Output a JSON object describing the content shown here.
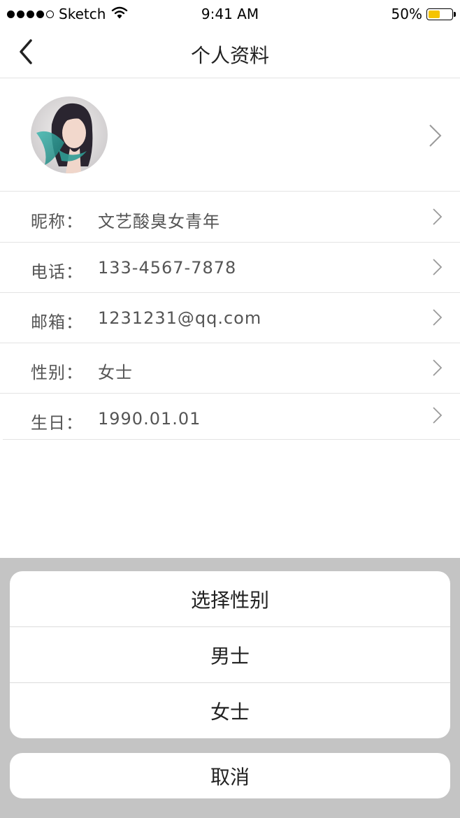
{
  "status_bar": {
    "carrier": "Sketch",
    "time": "9:41 AM",
    "battery": "50%",
    "battery_level": 0.5,
    "battery_color": "#f5c400"
  },
  "nav": {
    "title": "个人资料",
    "back_icon": "chevron-left-icon"
  },
  "profile": {
    "rows": [
      {
        "label": "昵称：",
        "value": "文艺酸臭女青年"
      },
      {
        "label": "电话：",
        "value": "133-4567-7878"
      },
      {
        "label": "邮箱：",
        "value": "1231231@qq.com"
      },
      {
        "label": "性别：",
        "value": "女士"
      },
      {
        "label": "生日：",
        "value": "1990.01.01"
      }
    ]
  },
  "action_sheet": {
    "title": "选择性别",
    "options": [
      "男士",
      "女士"
    ],
    "cancel": "取消"
  }
}
